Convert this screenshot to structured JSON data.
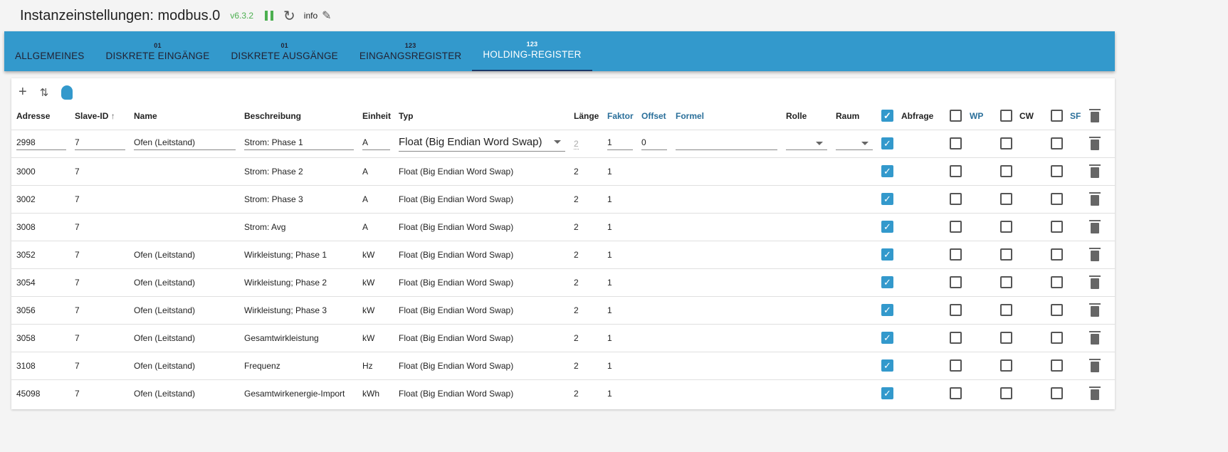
{
  "header": {
    "title": "Instanzeinstellungen: modbus.0",
    "version": "v6.3.2",
    "info": "info"
  },
  "tabs": [
    {
      "label": "Allgemeines",
      "sup": ""
    },
    {
      "label": "Diskrete Eingänge",
      "sup": "01"
    },
    {
      "label": "Diskrete Ausgänge",
      "sup": "01"
    },
    {
      "label": "Eingangsregister",
      "sup": "123"
    },
    {
      "label": "Holding-Register",
      "sup": "123"
    }
  ],
  "columns": {
    "adresse": "Adresse",
    "slave": "Slave-ID",
    "name": "Name",
    "beschreibung": "Beschreibung",
    "einheit": "Einheit",
    "typ": "Typ",
    "laenge": "Länge",
    "faktor": "Faktor",
    "offset": "Offset",
    "formel": "Formel",
    "rolle": "Rolle",
    "raum": "Raum",
    "abfrage": "Abfrage",
    "wp": "WP",
    "cw": "CW",
    "sf": "SF"
  },
  "header_checks": {
    "abfrage": true,
    "wp": false,
    "cw": false,
    "sf": false
  },
  "rows": [
    {
      "adresse": "2998",
      "slave": "7",
      "name": "Ofen (Leitstand)",
      "beschreibung": "Strom: Phase 1",
      "einheit": "A",
      "typ": "Float (Big Endian Word Swap)",
      "laenge": "2",
      "faktor": "1",
      "offset": "0",
      "abfrage": true,
      "wp": false,
      "cw": false,
      "sf": false
    },
    {
      "adresse": "3000",
      "slave": "7",
      "name": "",
      "beschreibung": "Strom: Phase 2",
      "einheit": "A",
      "typ": "Float (Big Endian Word Swap)",
      "laenge": "2",
      "faktor": "1",
      "offset": "",
      "abfrage": true,
      "wp": false,
      "cw": false,
      "sf": false
    },
    {
      "adresse": "3002",
      "slave": "7",
      "name": "",
      "beschreibung": "Strom: Phase 3",
      "einheit": "A",
      "typ": "Float (Big Endian Word Swap)",
      "laenge": "2",
      "faktor": "1",
      "offset": "",
      "abfrage": true,
      "wp": false,
      "cw": false,
      "sf": false
    },
    {
      "adresse": "3008",
      "slave": "7",
      "name": "",
      "beschreibung": "Strom: Avg",
      "einheit": "A",
      "typ": "Float (Big Endian Word Swap)",
      "laenge": "2",
      "faktor": "1",
      "offset": "",
      "abfrage": true,
      "wp": false,
      "cw": false,
      "sf": false
    },
    {
      "adresse": "3052",
      "slave": "7",
      "name": "Ofen (Leitstand)",
      "beschreibung": "Wirkleistung; Phase 1",
      "einheit": "kW",
      "typ": "Float (Big Endian Word Swap)",
      "laenge": "2",
      "faktor": "1",
      "offset": "",
      "abfrage": true,
      "wp": false,
      "cw": false,
      "sf": false
    },
    {
      "adresse": "3054",
      "slave": "7",
      "name": "Ofen (Leitstand)",
      "beschreibung": "Wirkleistung; Phase 2",
      "einheit": "kW",
      "typ": "Float (Big Endian Word Swap)",
      "laenge": "2",
      "faktor": "1",
      "offset": "",
      "abfrage": true,
      "wp": false,
      "cw": false,
      "sf": false
    },
    {
      "adresse": "3056",
      "slave": "7",
      "name": "Ofen (Leitstand)",
      "beschreibung": "Wirkleistung; Phase 3",
      "einheit": "kW",
      "typ": "Float (Big Endian Word Swap)",
      "laenge": "2",
      "faktor": "1",
      "offset": "",
      "abfrage": true,
      "wp": false,
      "cw": false,
      "sf": false
    },
    {
      "adresse": "3058",
      "slave": "7",
      "name": "Ofen (Leitstand)",
      "beschreibung": "Gesamtwirkleistung",
      "einheit": "kW",
      "typ": "Float (Big Endian Word Swap)",
      "laenge": "2",
      "faktor": "1",
      "offset": "",
      "abfrage": true,
      "wp": false,
      "cw": false,
      "sf": false
    },
    {
      "adresse": "3108",
      "slave": "7",
      "name": "Ofen (Leitstand)",
      "beschreibung": "Frequenz",
      "einheit": "Hz",
      "typ": "Float (Big Endian Word Swap)",
      "laenge": "2",
      "faktor": "1",
      "offset": "",
      "abfrage": true,
      "wp": false,
      "cw": false,
      "sf": false
    },
    {
      "adresse": "45098",
      "slave": "7",
      "name": "Ofen (Leitstand)",
      "beschreibung": "Gesamtwirkenergie-Import",
      "einheit": "kWh",
      "typ": "Float (Big Endian Word Swap)",
      "laenge": "2",
      "faktor": "1",
      "offset": "",
      "abfrage": true,
      "wp": false,
      "cw": false,
      "sf": false
    }
  ]
}
